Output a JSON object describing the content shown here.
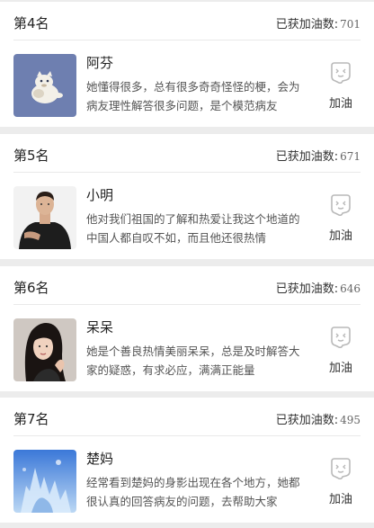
{
  "cards": [
    {
      "rank": "第4名",
      "score_label": "已获加油数:",
      "score": "701",
      "name": "阿芬",
      "desc": "她懂得很多，总有很多奇奇怪怪的梗，会为病友理性解答很多问题，是个模范病友",
      "cheer_label": "加油",
      "avatar_icon": "cartoon-animal-avatar"
    },
    {
      "rank": "第5名",
      "score_label": "已获加油数:",
      "score": "671",
      "name": "小明",
      "desc": "他对我们祖国的了解和热爱让我这个地道的中国人都自叹不如，而且他还很热情",
      "cheer_label": "加油",
      "avatar_icon": "man-photo-avatar"
    },
    {
      "rank": "第6名",
      "score_label": "已获加油数:",
      "score": "646",
      "name": "呆呆",
      "desc": "她是个善良热情美丽呆呆，总是及时解答大家的疑惑，有求必应，满满正能量",
      "cheer_label": "加油",
      "avatar_icon": "woman-photo-avatar"
    },
    {
      "rank": "第7名",
      "score_label": "已获加油数:",
      "score": "495",
      "name": "楚妈",
      "desc": "经常看到楚妈的身影出现在各个地方，她都很认真的回答病友的问题，去帮助大家",
      "cheer_label": "加油",
      "avatar_icon": "ice-castle-avatar"
    }
  ]
}
